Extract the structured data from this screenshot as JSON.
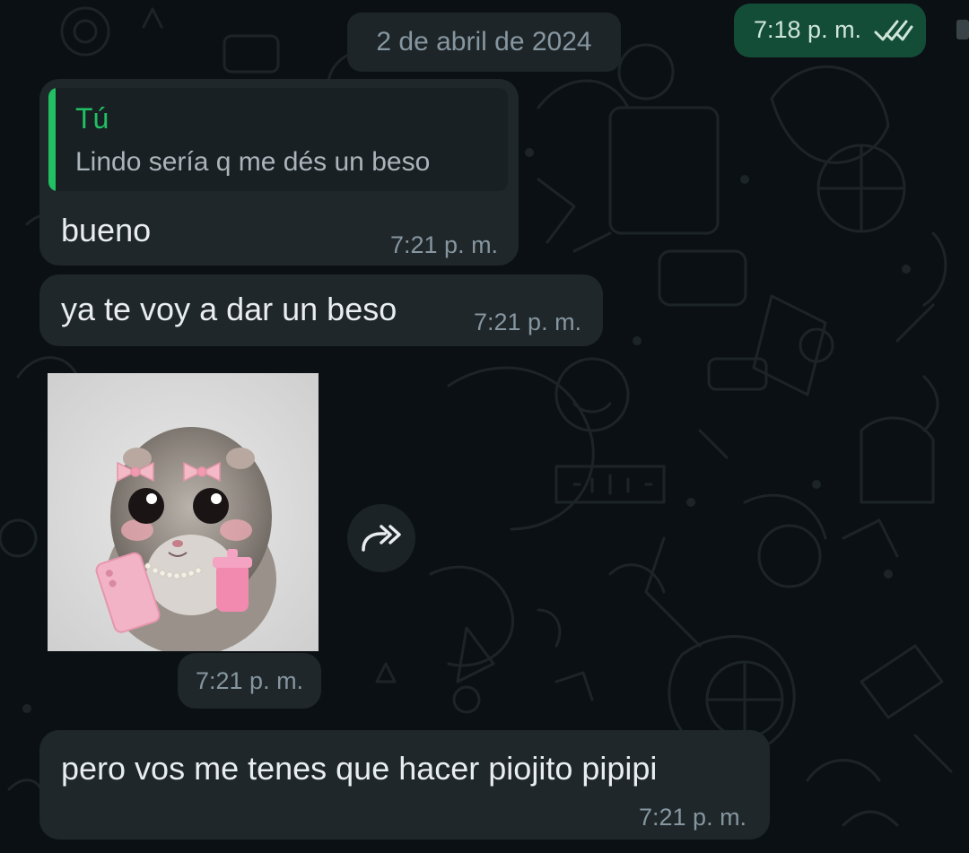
{
  "date_chip": "2 de abril de 2024",
  "outgoing_top": {
    "time": "7:18 p. m.",
    "status_icon": "double-check-icon"
  },
  "messages": [
    {
      "quote_author": "Tú",
      "quote_text": "Lindo sería q me dés un beso",
      "text": "bueno",
      "time": "7:21 p. m."
    },
    {
      "text": "ya te voy a dar un beso",
      "time": "7:21 p. m."
    },
    {
      "type": "sticker-image",
      "image_icon": "hamster-sticker-image",
      "time": "7:21 p. m.",
      "action_icon": "forward-icon"
    },
    {
      "text": "pero vos me tenes que hacer piojito pipipi",
      "time": "7:21 p. m."
    }
  ],
  "colors": {
    "background": "#0b1014",
    "incoming_bubble": "#1f272a",
    "outgoing_bubble": "#144d37",
    "quote_accent": "#21c063",
    "timestamp": "#8696a0"
  }
}
